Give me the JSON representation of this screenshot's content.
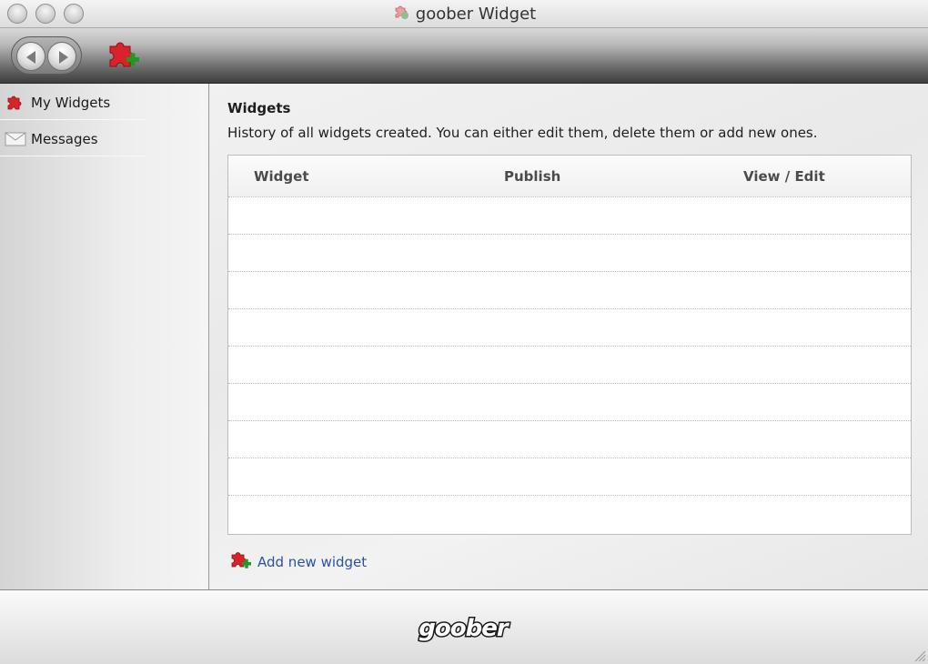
{
  "window": {
    "title": "goober Widget"
  },
  "toolbar": {
    "icons": [
      "back-arrow-icon",
      "forward-arrow-icon",
      "add-widget-icon"
    ]
  },
  "sidebar": {
    "items": [
      {
        "label": "My Widgets",
        "icon": "puzzle-icon"
      },
      {
        "label": "Messages",
        "icon": "envelope-icon"
      }
    ]
  },
  "main": {
    "title": "Widgets",
    "description": "History of all widgets created. You can either edit them, delete them or add new ones.",
    "table": {
      "columns": [
        "Widget",
        "Publish",
        "View / Edit"
      ],
      "rows": []
    },
    "add_link": "Add new widget"
  },
  "footer": {
    "logo_text": "goober"
  },
  "colors": {
    "accent_link": "#2a52a0",
    "puzzle_red": "#d8232a",
    "plus_green": "#1c9a2a"
  }
}
